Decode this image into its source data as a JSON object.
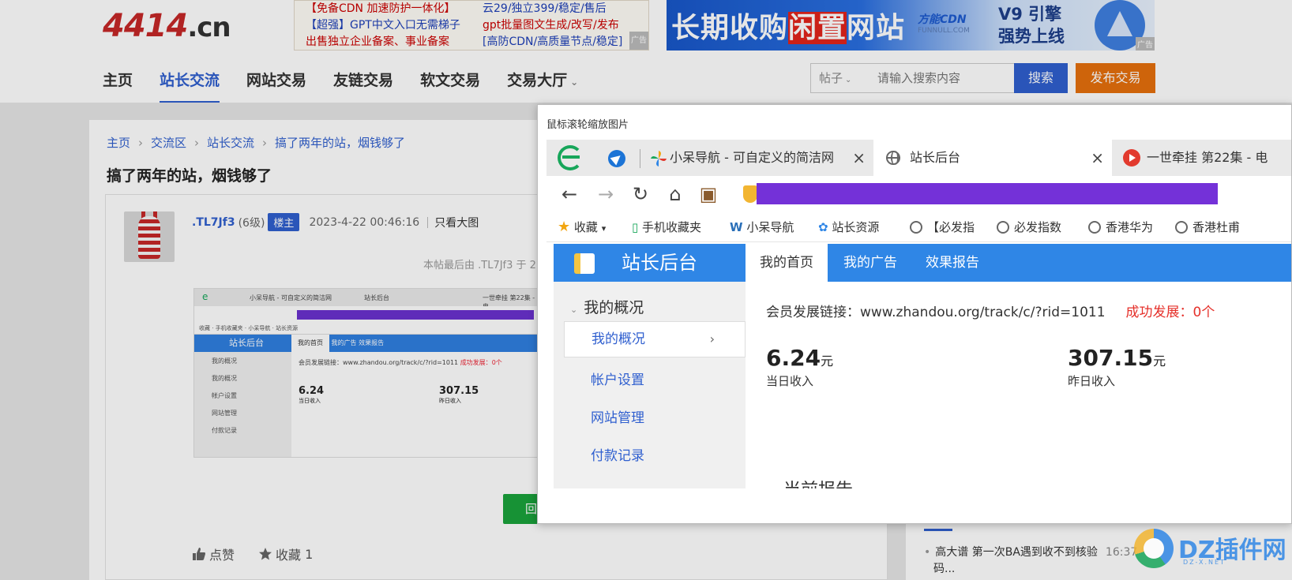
{
  "site": {
    "logo_main": "4414",
    "logo_tld": ".cn",
    "ad_text": {
      "col1": [
        "【免备CDN 加速防护一体化】",
        "【超强】GPT中文入口无需梯子",
        "出售独立企业备案、事业备案"
      ],
      "col2": [
        "云29/独立399/稳定/售后",
        "gpt批量图文生成/改写/发布",
        "[高防CDN/高质量节点/稳定]"
      ],
      "badge": "广告"
    },
    "ad_banner": {
      "text_pre": "长期收购",
      "text_hl": "闲置",
      "text_post": "网站",
      "brand": "方能CDN",
      "brand_sub": "FUNNULL.COM",
      "v9_line1": "V9 引擎",
      "v9_line2": "强势上线",
      "badge": "广告"
    }
  },
  "nav": {
    "items": [
      "主页",
      "站长交流",
      "网站交易",
      "友链交易",
      "软文交易",
      "交易大厅"
    ],
    "active_index": 1
  },
  "search": {
    "type": "帖子",
    "placeholder": "请输入搜索内容",
    "button": "搜索"
  },
  "publish_button": "发布交易",
  "breadcrumb": [
    "主页",
    "交流区",
    "站长交流",
    "搞了两年的站，烟钱够了"
  ],
  "thread": {
    "title": "搞了两年的站，烟钱够了",
    "author": ".TL7Jf3",
    "level": "(6级)",
    "host_badge": "楼主",
    "date": "2023-4-22 00:46:16",
    "only_host": "只看大图",
    "last_edited": "本帖最后由 .TL7Jf3 于 2",
    "reply_button": "回",
    "like": "点赞",
    "favorite": "收藏",
    "favorite_count": "1"
  },
  "sidebar_news": {
    "title": "高大谱 第一次BA遇到收不到核验",
    "title_cont": "码...",
    "time": "16:37"
  },
  "zoom_popup": {
    "hint": "鼠标滚轮缩放图片",
    "tabs": [
      {
        "label": "小呆导航 - 可自定义的简洁网",
        "close": "×"
      },
      {
        "label": "站长后台",
        "close": "×"
      },
      {
        "label": "一世牵挂 第22集 - 电"
      }
    ],
    "bookmarks": [
      "收藏",
      "手机收藏夹",
      "小呆导航",
      "站长资源",
      "【必发指",
      "必发指数",
      "香港华为",
      "香港杜甫"
    ],
    "admin": {
      "brand": "站长后台",
      "tabs": [
        "我的首页",
        "我的广告",
        "效果报告"
      ],
      "group": "我的概况",
      "active_item": "我的概况",
      "items": [
        "帐户设置",
        "网站管理",
        "付款记录"
      ],
      "member_link_label": "会员发展链接：",
      "member_link_url": "www.zhandou.org/track/c/?rid=1011",
      "success_label": "成功发展：",
      "success_count": "0个",
      "today_amount": "6.24",
      "today_unit": "元",
      "today_label": "当日收入",
      "yesterday_amount": "307.15",
      "yesterday_unit": "元",
      "yesterday_label": "昨日收入",
      "report_heading": "当前报告"
    }
  },
  "watermark": {
    "text": "DZ插件网",
    "sub": "DZ-X.NET"
  }
}
